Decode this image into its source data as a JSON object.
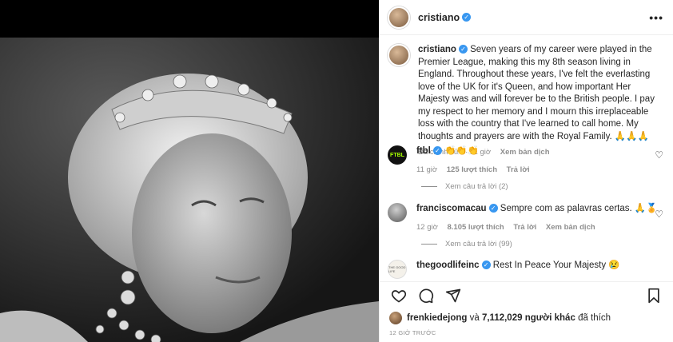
{
  "post": {
    "username": "cristiano",
    "more_label": "•••"
  },
  "caption": {
    "username": "cristiano",
    "text": "Seven years of my career were played in the Premier League, making this my 8th season living in England. Throughout these years, I've felt the everlasting love of the UK for it's Queen, and how important Her Majesty was and will forever be to the British people. I pay my respect to her memory and I mourn this irreplaceable loss with the country that I've learned to call home. My thoughts and prayers are with the Royal Family. 🙏🙏🙏",
    "edited": "Đã chỉnh sửa · 11 giờ",
    "translate": "Xem bản dịch"
  },
  "comments": [
    {
      "username": "ftbl",
      "avatar_text": "FTBL",
      "text": "👏👏👏",
      "time": "11 giờ",
      "likes": "125 lượt thích",
      "reply": "Trả lời",
      "view_replies": "Xem câu trả lời (2)"
    },
    {
      "username": "franciscomacau",
      "text": "Sempre com as palavras certas. 🙏🏅",
      "time": "12 giờ",
      "likes": "8.105 lượt thích",
      "reply": "Trả lời",
      "translate": "Xem bản dịch",
      "view_replies": "Xem câu trả lời (99)"
    },
    {
      "username": "thegoodlifeinc",
      "avatar_text": "THE GOOD LIFE",
      "text": "Rest In Peace Your Majesty 😢"
    }
  ],
  "likes": {
    "user": "frenkiedejong",
    "connector": "và",
    "others": "7,112,029 người khác",
    "suffix": "đã thích"
  },
  "time_ago": "12 GIỜ TRƯỚC",
  "icons": {
    "heart": "heart-icon",
    "comment": "comment-icon",
    "share": "share-icon",
    "save": "bookmark-icon",
    "verified": "verified-badge-icon",
    "more": "more-options-icon"
  },
  "colors": {
    "verified": "#3897f0",
    "meta_text": "#8e8e8e"
  }
}
